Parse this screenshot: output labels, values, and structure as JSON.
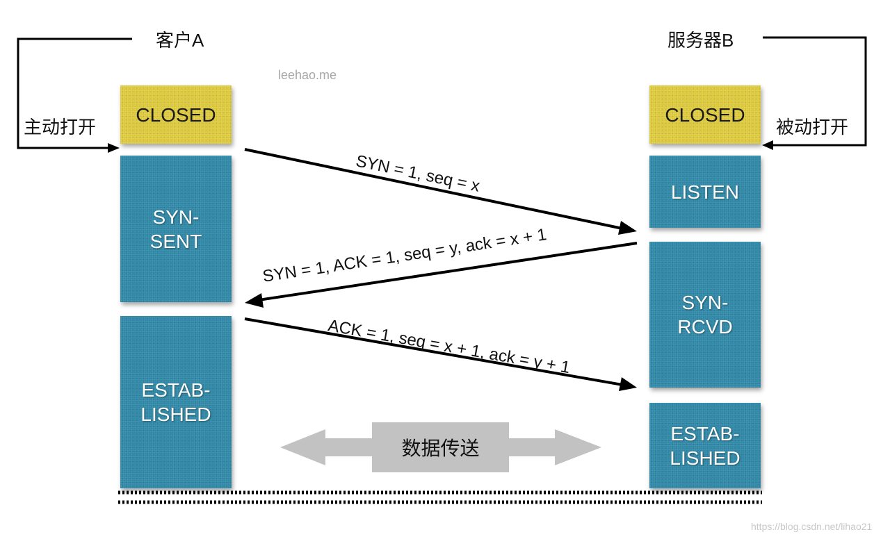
{
  "title_client": "客户A",
  "title_server": "服务器B",
  "watermark": "leehao.me",
  "footer_watermark": "https://blog.csdn.net/lihao21",
  "client_open_label": "主动打开",
  "server_open_label": "被动打开",
  "colors": {
    "closed": "#dcc83a",
    "state": "#3189a8",
    "data_transfer": "#c2c2c2"
  },
  "client_states": [
    {
      "label": "CLOSED",
      "color": "yellow"
    },
    {
      "label_line1": "SYN-",
      "label_line2": "SENT",
      "color": "blue"
    },
    {
      "label_line1": "ESTAB-",
      "label_line2": "LISHED",
      "color": "blue"
    }
  ],
  "server_states": [
    {
      "label": "CLOSED",
      "color": "yellow"
    },
    {
      "label": "LISTEN",
      "color": "blue"
    },
    {
      "label_line1": "SYN-",
      "label_line2": "RCVD",
      "color": "blue"
    },
    {
      "label_line1": "ESTAB-",
      "label_line2": "LISHED",
      "color": "blue"
    }
  ],
  "messages": [
    {
      "text": "SYN = 1, seq = x",
      "direction": "client-to-server"
    },
    {
      "text": "SYN = 1, ACK = 1, seq = y, ack = x + 1",
      "direction": "server-to-client"
    },
    {
      "text": "ACK = 1, seq = x + 1, ack = y + 1",
      "direction": "client-to-server"
    }
  ],
  "data_transfer_label": "数据传送"
}
